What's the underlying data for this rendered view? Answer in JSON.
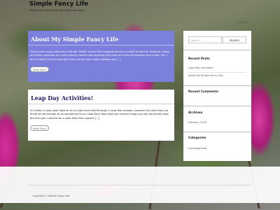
{
  "site": {
    "title": "Simple Fancy Life",
    "description": "Making the most out of life's little moments",
    "top_link": "Leap Day"
  },
  "posts": [
    {
      "title": "About My Simple Fancy Life",
      "excerpt": "This is just a quick post very informal \"Hello!\" As the title suggests we live a pretty simple life. However, those are these moments as a mom where I realize how amazing and extra our lives are because of our kids. Yes, I am a mother to three beautiful kids and we may make mistakes yet [...]",
      "read_more": "Read More"
    },
    {
      "title": "Leap Day Activities!",
      "excerpt": "It's finally a Leap year! Now all of my kids have lived through a Leap Year already, however this year they are finally all old enough to do something fun on Leap Day! Now there are several things you can do activity wise but this year I want to do a Leap Year time capsule [...]",
      "read_more": "Read More"
    }
  ],
  "sidebar": {
    "search": {
      "placeholder": "Search ...",
      "button": "SEARCH"
    },
    "recent_posts": {
      "title": "Recent Posts",
      "items": [
        "Leap Day Activities!",
        "About My Simple Fancy Life"
      ]
    },
    "recent_comments": {
      "title": "Recent Comments"
    },
    "archives": {
      "title": "Archives",
      "items": [
        "February 2020"
      ]
    },
    "categories": {
      "title": "Categories",
      "items": [
        "Uncategorized"
      ]
    }
  },
  "footer": {
    "copyright": "Copyright © Simple Fancy Life"
  }
}
